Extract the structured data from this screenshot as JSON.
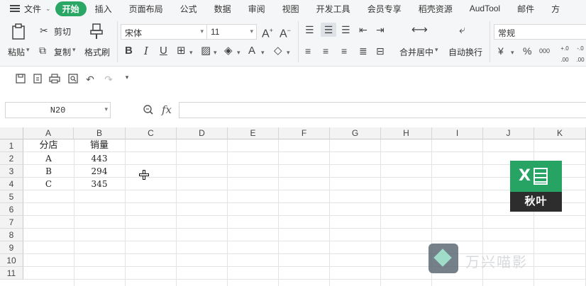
{
  "menubar": {
    "file": "文件",
    "tabs": [
      "开始",
      "插入",
      "页面布局",
      "公式",
      "数据",
      "审阅",
      "视图",
      "开发工具",
      "会员专享",
      "稻壳资源",
      "AudTool",
      "邮件",
      "方"
    ]
  },
  "ribbon": {
    "paste": "粘贴",
    "cut": "剪切",
    "copy": "复制",
    "format_painter": "格式刷",
    "font_name": "宋体",
    "font_size": "11",
    "merge_center": "合并居中",
    "wrap_text": "自动换行",
    "number_format": "常规",
    "currency_symbol": "¥",
    "percent_symbol": "%",
    "thousands_symbol": "000",
    "inc_decimal": "+.0 .00",
    "dec_decimal": "-.0 .00"
  },
  "formula_bar": {
    "name_box": "N20",
    "fx": "fx",
    "value": ""
  },
  "sheet": {
    "columns": [
      "A",
      "B",
      "C",
      "D",
      "E",
      "F",
      "G",
      "H",
      "I",
      "J",
      "K"
    ],
    "rows": [
      "1",
      "2",
      "3",
      "4",
      "5",
      "6",
      "7",
      "8",
      "9",
      "10",
      "11"
    ],
    "cells": [
      [
        "分店",
        "销量"
      ],
      [
        "A",
        "443"
      ],
      [
        "B",
        "294"
      ],
      [
        "C",
        "345"
      ]
    ]
  },
  "overlay": {
    "logo_letter": "X",
    "logo_text": "秋叶",
    "watermark_text": "万兴喵影"
  }
}
